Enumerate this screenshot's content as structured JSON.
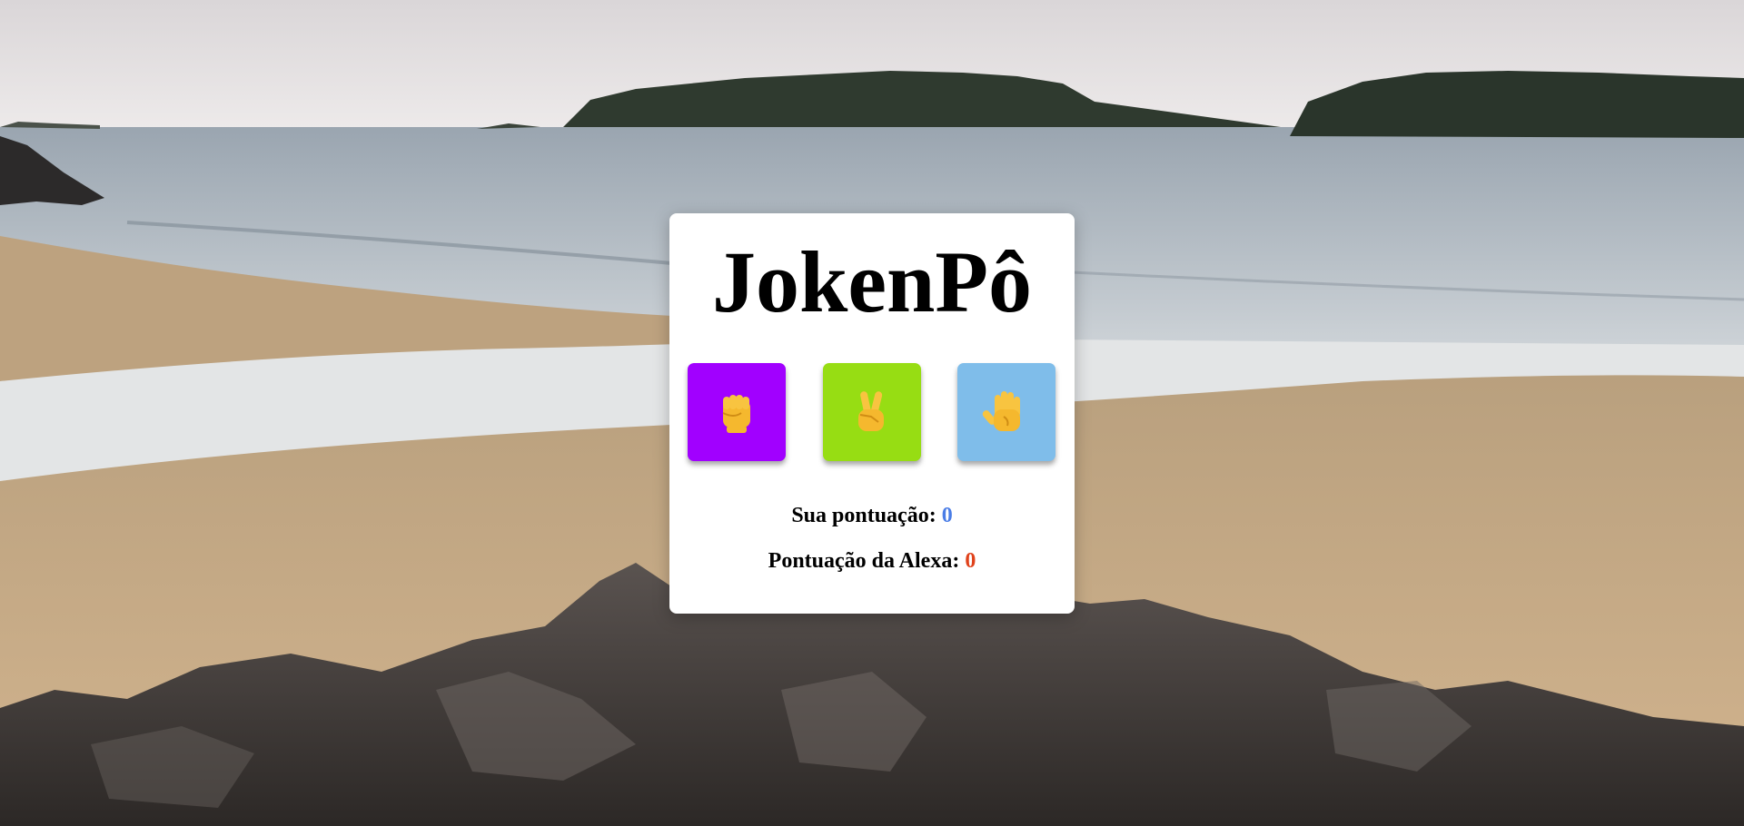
{
  "game": {
    "title": "JokenPô",
    "choices": [
      {
        "id": "rock",
        "icon": "raised-fist-icon",
        "color": "#a100ff"
      },
      {
        "id": "scissors",
        "icon": "victory-hand-icon",
        "color": "#97dd13"
      },
      {
        "id": "paper",
        "icon": "raised-hand-icon",
        "color": "#7fbdea"
      }
    ],
    "player_score": {
      "label": "Sua pontuação:",
      "value": "0",
      "color": "#4a7de6"
    },
    "alexa_score": {
      "label": "Pontuação da Alexa:",
      "value": "0",
      "color": "#e0421b"
    }
  },
  "background": {
    "sky_color": "#e9e5e6",
    "sea_color": "#a9b2bb",
    "sand_color": "#c9ad86",
    "rock_color": "#3f3a38"
  }
}
